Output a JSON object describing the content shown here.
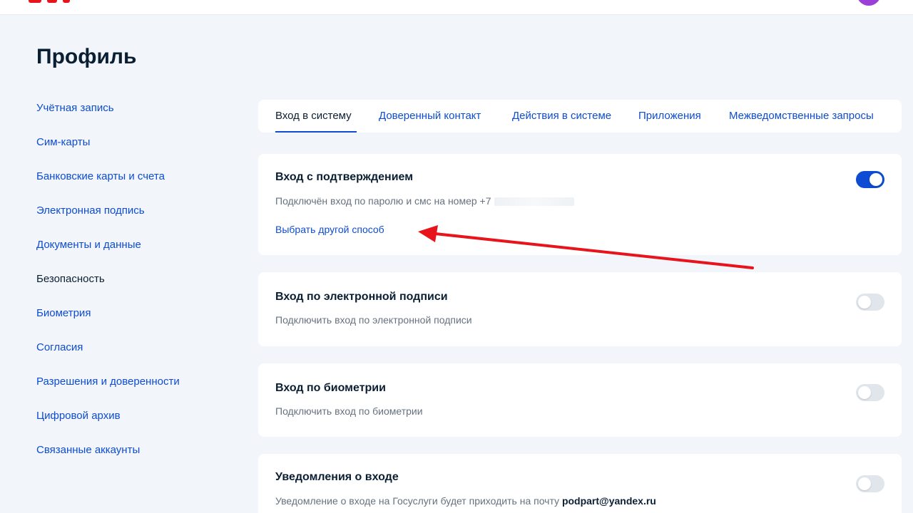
{
  "page": {
    "title": "Профиль"
  },
  "sidebar": {
    "items": [
      {
        "label": "Учётная запись",
        "active": false
      },
      {
        "label": "Сим-карты",
        "active": false
      },
      {
        "label": "Банковские карты и счета",
        "active": false
      },
      {
        "label": "Электронная подпись",
        "active": false
      },
      {
        "label": "Документы и данные",
        "active": false
      },
      {
        "label": "Безопасность",
        "active": true
      },
      {
        "label": "Биометрия",
        "active": false
      },
      {
        "label": "Согласия",
        "active": false
      },
      {
        "label": "Разрешения и доверенности",
        "active": false
      },
      {
        "label": "Цифровой архив",
        "active": false
      },
      {
        "label": "Связанные аккаунты",
        "active": false
      }
    ]
  },
  "tabs": [
    {
      "label": "Вход в систему",
      "active": true
    },
    {
      "label": "Доверенный контакт",
      "active": false
    },
    {
      "label": "Действия в системе",
      "active": false
    },
    {
      "label": "Приложения",
      "active": false
    },
    {
      "label": "Межведомственные запросы",
      "active": false
    }
  ],
  "cards": {
    "confirm": {
      "title": "Вход с подтверждением",
      "desc": "Подключён вход по паролю и смс на номер +7",
      "link": "Выбрать другой способ",
      "toggle_on": true
    },
    "esign": {
      "title": "Вход по электронной подписи",
      "desc": "Подключить вход по электронной подписи",
      "toggle_on": false
    },
    "biometry": {
      "title": "Вход по биометрии",
      "desc": "Подключить вход по биометрии",
      "toggle_on": false
    },
    "notify": {
      "title": "Уведомления о входе",
      "desc": "Уведомление о входе на Госуслуги будет приходить на почту",
      "email": "podpart@yandex.ru",
      "toggle_on": false
    }
  },
  "colors": {
    "accent": "#0d4cd3",
    "background": "#f2f5f9",
    "text": "#0b1f33",
    "muted": "#66727f",
    "annotation": "#e8141c",
    "avatar": "#9b3fd6"
  }
}
